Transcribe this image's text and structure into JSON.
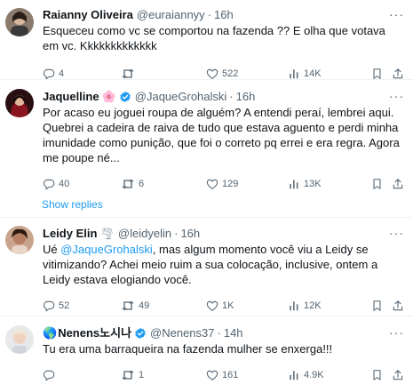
{
  "tweets": [
    {
      "name": "Raianny Oliveira",
      "handle": "@euraiannyy",
      "time": "16h",
      "text": "Esqueceu como vc se comportou na fazenda ?? E olha que votava em vc. Kkkkkkkkkkkkk",
      "replies": "4",
      "retweets": "",
      "likes": "522",
      "views": "14K"
    },
    {
      "name": "Jaquelline",
      "name_emoji": "🌸",
      "handle": "@JaqueGrohalski",
      "time": "16h",
      "text": "Por acaso eu joguei roupa de alguém? A entendi peraí, lembrei aqui. Quebrei a cadeira de raiva de tudo que estava aguento e perdi minha imunidade como punição, que foi o correto pq errei e era regra. Agora me poupe né...",
      "replies": "40",
      "retweets": "6",
      "likes": "129",
      "views": "13K"
    },
    {
      "name": "Leidy Elin",
      "name_emoji": "🌪",
      "handle": "@leidyelin",
      "time": "16h",
      "text_pre": "Ué ",
      "mention": "@JaqueGrohalski",
      "text_post": ", mas algum momento você viu a Leidy se vitimizando? Achei meio ruim a sua colocação, inclusive, ontem a Leidy estava elogiando você.",
      "replies": "52",
      "retweets": "49",
      "likes": "1K",
      "views": "12K"
    },
    {
      "name_prefix": "🌎",
      "name": "Nenens노시나",
      "handle": "@Nenens37",
      "time": "14h",
      "text": "Tu era uma barraqueira na fazenda mulher se enxerga!!!",
      "replies": "",
      "retweets": "1",
      "likes": "161",
      "views": "4.9K"
    }
  ],
  "show_replies_label": "Show replies",
  "more_label": "···",
  "dot": "·",
  "colors": {
    "accent": "#1d9bf0",
    "muted": "#536471",
    "verified_gold": "#e2b719"
  },
  "icons": [
    "reply-icon",
    "retweet-icon",
    "like-icon",
    "views-icon",
    "bookmark-icon",
    "share-icon",
    "verified-badge-icon"
  ]
}
